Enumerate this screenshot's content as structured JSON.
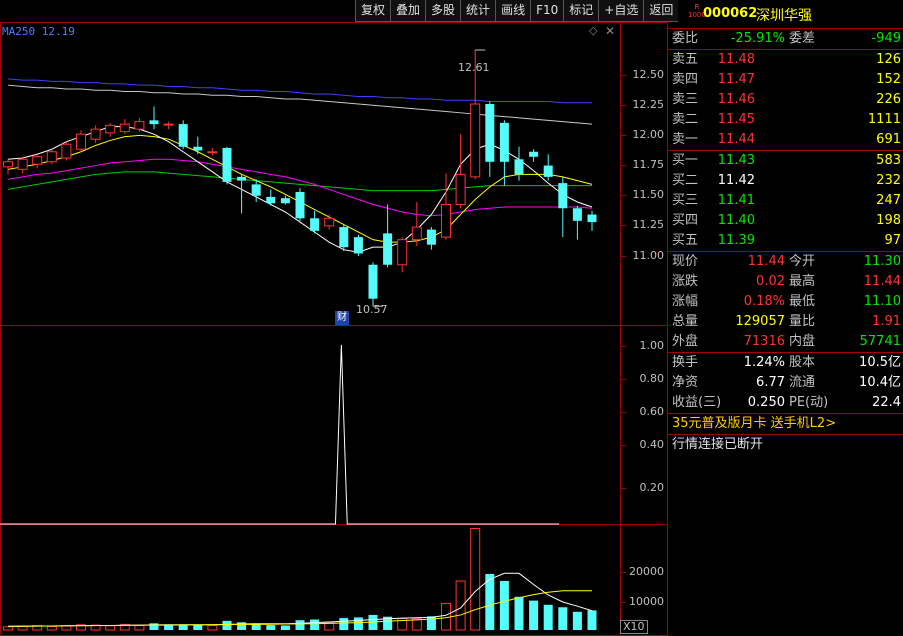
{
  "toolbar": [
    "复权",
    "叠加",
    "多股",
    "统计",
    "画线",
    "F10",
    "标记",
    "+自选",
    "返回"
  ],
  "ma_label": "MA250  12.19",
  "price_axis": [
    "12.50",
    "12.25",
    "12.00",
    "11.75",
    "11.50",
    "11.25",
    "11.00"
  ],
  "ind_axis": [
    "1.00",
    "0.80",
    "0.60",
    "0.40",
    "0.20"
  ],
  "vol_axis": [
    "20000",
    "10000"
  ],
  "high_label": "12.61",
  "low_label": "10.57",
  "cai_badge": "财",
  "x10": "X10",
  "colors": {
    "up": "#ff3232",
    "down": "#54fcfc",
    "ma250": "#4040ff",
    "frame": "#a00000"
  },
  "panel": {
    "badge_top": "R",
    "badge_bottom": "1000",
    "code": "000062",
    "name": "深圳华强",
    "weibi": {
      "label": "委比",
      "value": "-25.91%",
      "label2": "委差",
      "value2": "-949"
    },
    "asks": [
      {
        "label": "卖五",
        "price": "11.48",
        "vol": "126"
      },
      {
        "label": "卖四",
        "price": "11.47",
        "vol": "152"
      },
      {
        "label": "卖三",
        "price": "11.46",
        "vol": "226"
      },
      {
        "label": "卖二",
        "price": "11.45",
        "vol": "1111"
      },
      {
        "label": "卖一",
        "price": "11.44",
        "vol": "691"
      }
    ],
    "bids": [
      {
        "label": "买一",
        "price": "11.43",
        "vol": "583",
        "c": "green"
      },
      {
        "label": "买二",
        "price": "11.42",
        "vol": "232",
        "c": "white"
      },
      {
        "label": "买三",
        "price": "11.41",
        "vol": "247",
        "c": "green"
      },
      {
        "label": "买四",
        "price": "11.40",
        "vol": "198",
        "c": "green"
      },
      {
        "label": "买五",
        "price": "11.39",
        "vol": "97",
        "c": "green"
      }
    ],
    "quote": [
      {
        "l1": "现价",
        "v1": "11.44",
        "c1": "red",
        "l2": "今开",
        "v2": "11.30",
        "c2": "green"
      },
      {
        "l1": "涨跌",
        "v1": "0.02",
        "c1": "red",
        "l2": "最高",
        "v2": "11.44",
        "c2": "red"
      },
      {
        "l1": "涨幅",
        "v1": "0.18%",
        "c1": "red",
        "l2": "最低",
        "v2": "11.10",
        "c2": "green"
      },
      {
        "l1": "总量",
        "v1": "129057",
        "c1": "yellow",
        "l2": "量比",
        "v2": "1.91",
        "c2": "red"
      },
      {
        "l1": "外盘",
        "v1": "71316",
        "c1": "red",
        "l2": "内盘",
        "v2": "57741",
        "c2": "green"
      }
    ],
    "fundamentals": [
      {
        "l1": "换手",
        "v1": "1.24%",
        "l2": "股本",
        "v2": "10.5亿"
      },
      {
        "l1": "净资",
        "v1": "6.77",
        "l2": "流通",
        "v2": "10.4亿"
      },
      {
        "l1": "收益(三)",
        "v1": "0.250",
        "l2": "PE(动)",
        "v2": "22.4"
      }
    ],
    "promo": "35元普及版月卡 送手机L2>",
    "status": "行情连接已断开"
  },
  "chart_data": {
    "type": "candlestick",
    "ylim": [
      10.5,
      12.65
    ],
    "candles": [
      {
        "o": 11.68,
        "c": 11.72,
        "h": 11.74,
        "l": 11.62
      },
      {
        "o": 11.66,
        "c": 11.74,
        "h": 11.76,
        "l": 11.63
      },
      {
        "o": 11.7,
        "c": 11.76,
        "h": 11.79,
        "l": 11.67
      },
      {
        "o": 11.72,
        "c": 11.8,
        "h": 11.82,
        "l": 11.7
      },
      {
        "o": 11.75,
        "c": 11.86,
        "h": 11.88,
        "l": 11.73
      },
      {
        "o": 11.82,
        "c": 11.94,
        "h": 11.97,
        "l": 11.8
      },
      {
        "o": 11.9,
        "c": 11.98,
        "h": 12.01,
        "l": 11.87
      },
      {
        "o": 11.95,
        "c": 12.01,
        "h": 12.03,
        "l": 11.92
      },
      {
        "o": 11.96,
        "c": 12.02,
        "h": 12.06,
        "l": 11.94
      },
      {
        "o": 11.98,
        "c": 12.04,
        "h": 12.07,
        "l": 11.96
      },
      {
        "o": 12.05,
        "c": 12.02,
        "h": 12.16,
        "l": 11.98
      },
      {
        "o": 12.02,
        "c": 12.02,
        "h": 12.04,
        "l": 11.98
      },
      {
        "o": 12.02,
        "c": 11.84,
        "h": 12.05,
        "l": 11.82
      },
      {
        "o": 11.84,
        "c": 11.81,
        "h": 11.92,
        "l": 11.78
      },
      {
        "o": 11.8,
        "c": 11.8,
        "h": 11.83,
        "l": 11.77
      },
      {
        "o": 11.83,
        "c": 11.56,
        "h": 11.84,
        "l": 11.54
      },
      {
        "o": 11.6,
        "c": 11.57,
        "h": 11.62,
        "l": 11.31
      },
      {
        "o": 11.54,
        "c": 11.45,
        "h": 11.58,
        "l": 11.4
      },
      {
        "o": 11.44,
        "c": 11.39,
        "h": 11.5,
        "l": 11.37
      },
      {
        "o": 11.43,
        "c": 11.39,
        "h": 11.45,
        "l": 11.38
      },
      {
        "o": 11.48,
        "c": 11.27,
        "h": 11.51,
        "l": 11.25
      },
      {
        "o": 11.27,
        "c": 11.17,
        "h": 11.33,
        "l": 11.15
      },
      {
        "o": 11.21,
        "c": 11.27,
        "h": 11.3,
        "l": 11.18
      },
      {
        "o": 11.2,
        "c": 11.04,
        "h": 11.22,
        "l": 11.01
      },
      {
        "o": 11.12,
        "c": 10.99,
        "h": 11.14,
        "l": 10.97
      },
      {
        "o": 10.9,
        "c": 10.63,
        "h": 10.92,
        "l": 10.57
      },
      {
        "o": 11.15,
        "c": 10.9,
        "h": 11.38,
        "l": 10.88
      },
      {
        "o": 10.9,
        "c": 11.1,
        "h": 11.12,
        "l": 10.84
      },
      {
        "o": 11.1,
        "c": 11.2,
        "h": 11.4,
        "l": 11.05
      },
      {
        "o": 11.18,
        "c": 11.06,
        "h": 11.2,
        "l": 11.02
      },
      {
        "o": 11.12,
        "c": 11.38,
        "h": 11.63,
        "l": 11.1
      },
      {
        "o": 11.38,
        "c": 11.62,
        "h": 11.94,
        "l": 11.35
      },
      {
        "o": 11.6,
        "c": 12.18,
        "h": 12.61,
        "l": 11.58
      },
      {
        "o": 12.18,
        "c": 11.72,
        "h": 12.2,
        "l": 11.6
      },
      {
        "o": 12.03,
        "c": 11.72,
        "h": 12.05,
        "l": 11.53
      },
      {
        "o": 11.74,
        "c": 11.62,
        "h": 11.84,
        "l": 11.57
      },
      {
        "o": 11.8,
        "c": 11.76,
        "h": 11.82,
        "l": 11.72
      },
      {
        "o": 11.69,
        "c": 11.6,
        "h": 11.78,
        "l": 11.57
      },
      {
        "o": 11.55,
        "c": 11.35,
        "h": 11.6,
        "l": 11.12
      },
      {
        "o": 11.35,
        "c": 11.25,
        "h": 11.37,
        "l": 11.1
      },
      {
        "o": 11.3,
        "c": 11.24,
        "h": 11.33,
        "l": 11.17
      }
    ],
    "ma_fast": [
      11.74,
      11.75,
      11.78,
      11.82,
      11.88,
      11.92,
      11.96,
      12.0,
      12.0,
      11.98,
      11.94,
      11.88,
      11.8,
      11.72,
      11.64,
      11.56,
      11.5,
      11.44,
      11.38,
      11.32,
      11.24,
      11.16,
      11.08,
      11.02,
      11.0,
      11.04,
      11.04,
      11.08,
      11.18,
      11.3,
      11.48,
      11.7,
      11.82,
      11.86,
      11.81,
      11.74,
      11.65,
      11.55,
      11.46,
      11.4,
      11.36
    ],
    "ma_mid": [
      11.66,
      11.68,
      11.7,
      11.73,
      11.76,
      11.8,
      11.85,
      11.89,
      11.92,
      11.93,
      11.92,
      11.9,
      11.85,
      11.8,
      11.74,
      11.68,
      11.62,
      11.57,
      11.52,
      11.46,
      11.4,
      11.34,
      11.28,
      11.22,
      11.16,
      11.1,
      11.08,
      11.08,
      11.09,
      11.12,
      11.18,
      11.3,
      11.42,
      11.52,
      11.6,
      11.62,
      11.62,
      11.62,
      11.6,
      11.57,
      11.54
    ],
    "ma_long": [
      11.58,
      11.6,
      11.62,
      11.63,
      11.65,
      11.67,
      11.69,
      11.71,
      11.72,
      11.73,
      11.74,
      11.74,
      11.73,
      11.72,
      11.7,
      11.68,
      11.66,
      11.64,
      11.62,
      11.6,
      11.57,
      11.54,
      11.5,
      11.46,
      11.42,
      11.38,
      11.35,
      11.32,
      11.3,
      11.29,
      11.3,
      11.32,
      11.34,
      11.35,
      11.36,
      11.36,
      11.36,
      11.36,
      11.36,
      11.36,
      11.35
    ],
    "ma_120": [
      11.5,
      11.52,
      11.54,
      11.56,
      11.58,
      11.6,
      11.62,
      11.63,
      11.64,
      11.64,
      11.64,
      11.63,
      11.62,
      11.61,
      11.6,
      11.59,
      11.58,
      11.57,
      11.56,
      11.55,
      11.54,
      11.53,
      11.52,
      11.51,
      11.5,
      11.49,
      11.49,
      11.49,
      11.49,
      11.49,
      11.5,
      11.51,
      11.52,
      11.53,
      11.53,
      11.53,
      11.53,
      11.53,
      11.53,
      11.53,
      11.53
    ],
    "ma_200": [
      12.33,
      12.32,
      12.31,
      12.31,
      12.3,
      12.3,
      12.29,
      12.29,
      12.28,
      12.28,
      12.27,
      12.27,
      12.26,
      12.26,
      12.25,
      12.25,
      12.24,
      12.24,
      12.23,
      12.22,
      12.22,
      12.21,
      12.2,
      12.19,
      12.18,
      12.17,
      12.16,
      12.15,
      12.14,
      12.13,
      12.12,
      12.11,
      12.1,
      12.09,
      12.08,
      12.07,
      12.06,
      12.05,
      12.04,
      12.03,
      12.02
    ],
    "ma_250": [
      12.38,
      12.37,
      12.37,
      12.36,
      12.36,
      12.35,
      12.35,
      12.34,
      12.34,
      12.33,
      12.33,
      12.32,
      12.32,
      12.31,
      12.31,
      12.3,
      12.29,
      12.29,
      12.28,
      12.28,
      12.27,
      12.26,
      12.26,
      12.25,
      12.24,
      12.24,
      12.23,
      12.23,
      12.22,
      12.22,
      12.21,
      12.21,
      12.21,
      12.2,
      12.2,
      12.2,
      12.2,
      12.2,
      12.19,
      12.19,
      12.19
    ],
    "indicator": {
      "ylim": [
        0,
        1.05
      ],
      "values": [
        0,
        0,
        0,
        0,
        0,
        0,
        0,
        0,
        0,
        0,
        0,
        0,
        0,
        0,
        0,
        0,
        0,
        0,
        0,
        0,
        0,
        0,
        0,
        0,
        0,
        0,
        0,
        0,
        0,
        0,
        0,
        0,
        0,
        0,
        0,
        0,
        0,
        0,
        0,
        0,
        0,
        0,
        0,
        0,
        0,
        0,
        0,
        0,
        0,
        0,
        0,
        0,
        0,
        0,
        0,
        0,
        0,
        0,
        1,
        0,
        0,
        0,
        0,
        0,
        0,
        0,
        0,
        0,
        0,
        0,
        0,
        0,
        0,
        0,
        0,
        0,
        0,
        0,
        0,
        0,
        0,
        0,
        0,
        0,
        0,
        0,
        0,
        0,
        0,
        0,
        0,
        0,
        0,
        0,
        0,
        0
      ]
    },
    "volume": {
      "ylim": [
        0,
        30000
      ],
      "values": [
        900,
        1100,
        1300,
        1000,
        1200,
        1500,
        1400,
        1200,
        1600,
        1300,
        1900,
        1500,
        1400,
        1500,
        1300,
        2600,
        2200,
        1700,
        1400,
        1300,
        2800,
        3000,
        2200,
        3400,
        3600,
        4300,
        3800,
        3300,
        3200,
        3900,
        7600,
        14000,
        29000,
        16000,
        14000,
        9500,
        8400,
        7200,
        6500,
        5200,
        5600
      ],
      "ma1": [
        1000,
        1050,
        1100,
        1150,
        1200,
        1250,
        1300,
        1300,
        1350,
        1400,
        1450,
        1500,
        1500,
        1500,
        1500,
        1600,
        1700,
        1800,
        1800,
        1800,
        1900,
        2100,
        2300,
        2500,
        2700,
        3000,
        3200,
        3400,
        3500,
        3600,
        4200,
        6300,
        11000,
        14500,
        16200,
        16200,
        13000,
        10000,
        8000,
        6800,
        5500
      ],
      "ma2": [
        1100,
        1100,
        1150,
        1150,
        1200,
        1200,
        1250,
        1300,
        1300,
        1350,
        1400,
        1400,
        1450,
        1450,
        1500,
        1550,
        1600,
        1600,
        1650,
        1700,
        1750,
        1800,
        1900,
        2000,
        2100,
        2300,
        2500,
        2700,
        2900,
        3100,
        3500,
        4300,
        5800,
        7100,
        8200,
        9200,
        10100,
        10800,
        11200,
        11200,
        11200
      ],
      "up": [
        true,
        true,
        true,
        true,
        true,
        true,
        true,
        true,
        true,
        true,
        false,
        false,
        false,
        false,
        true,
        false,
        false,
        false,
        false,
        false,
        false,
        false,
        true,
        false,
        false,
        false,
        false,
        true,
        true,
        false,
        true,
        true,
        true,
        false,
        false,
        false,
        false,
        false,
        false,
        false,
        false
      ]
    }
  }
}
